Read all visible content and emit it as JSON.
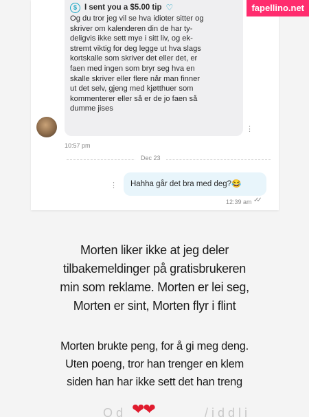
{
  "watermark": "fapellino.net",
  "message_in": {
    "tip_label": "I sent you a $5.00 tip",
    "lines": [
      "Og du tror jeg vil se hva idioter sitter og",
      "skriver om kalenderen din de har ty-",
      "deligvis ikke sett mye i sitt liv, og ek-",
      "stremt viktig for deg legge ut hva slags",
      "kortskalle som skriver det eller det, er",
      "faen med ingen som bryr seg hva en",
      "skalle skriver eller flere når man finner",
      "ut det selv, gjeng med kjøtthuer som",
      "kommenterer eller så er de jo faen så",
      "dumme jises"
    ],
    "time": "10:57 pm"
  },
  "date_divider": "Dec 23",
  "message_out": {
    "text": "Hahha går det bra med deg?😂",
    "time": "12:39 am"
  },
  "caption_1": "Morten liker ikke at jeg deler\ntilbakemeldinger på gratisbrukeren\nmin som reklame. Morten er lei seg,\nMorten er sint, Morten flyr i flint",
  "caption_2": "Morten brukte peng, for å gi meg deng.\nUten poeng, tror han trenger en klem\nsiden han har ikke sett det han treng",
  "bottom_row": {
    "hearts": "❤❤",
    "left_text": "O d",
    "right_text": "/ i d    d l i"
  },
  "icons": {
    "dollar": "dollar-circle-icon",
    "heart": "heart-outline-icon",
    "kebab": "more-vertical-icon",
    "read": "double-check-icon"
  },
  "colors": {
    "accent": "#1aa6c4",
    "watermark_bg": "#ff2c6e",
    "incoming_bubble": "#efeff1",
    "outgoing_bubble": "#e8f5fb",
    "hearts": "#e01b2e"
  }
}
